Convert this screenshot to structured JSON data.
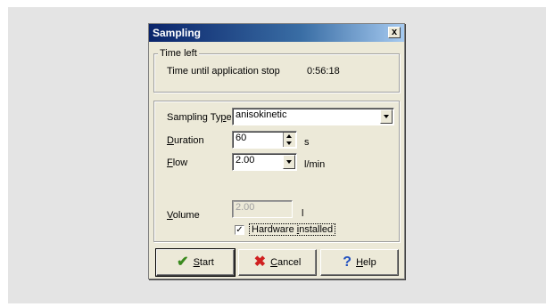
{
  "dialog": {
    "title": "Sampling",
    "close_label": "x"
  },
  "time_left": {
    "group_label": "Time left",
    "label": "Time until application stop",
    "value": "0:56:18"
  },
  "settings": {
    "sampling_type": {
      "label_pre": "Sampling Ty",
      "label_key": "p",
      "label_post": "e",
      "value": "anisokinetic"
    },
    "duration": {
      "label_key": "D",
      "label_post": "uration",
      "value": "60",
      "unit": "s"
    },
    "flow": {
      "label_key": "F",
      "label_post": "low",
      "value": "2.00",
      "unit": "l/min"
    },
    "volume": {
      "label_key": "V",
      "label_post": "olume",
      "value": "2.00",
      "unit": "l"
    },
    "hardware": {
      "checked": true,
      "check_mark": "✓",
      "label_pre": "Hardware ",
      "label_key": "i",
      "label_post": "nstalled"
    }
  },
  "buttons": {
    "start": {
      "key": "S",
      "rest": "tart",
      "icon": "✔",
      "icon_color": "#3a8a1e"
    },
    "cancel": {
      "key": "C",
      "rest": "ancel",
      "icon": "✖",
      "icon_color": "#d02020"
    },
    "help": {
      "key": "H",
      "rest": "elp",
      "icon": "?",
      "icon_color": "#2050c0"
    }
  }
}
